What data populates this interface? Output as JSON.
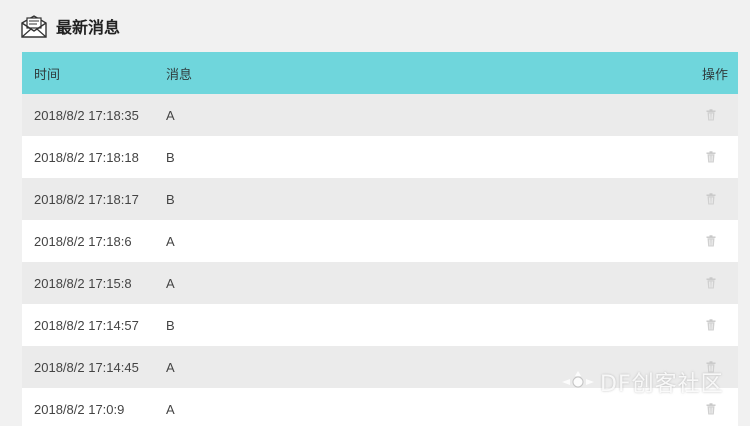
{
  "panel": {
    "title": "最新消息",
    "icon": "mail-envelope-icon"
  },
  "table": {
    "columns": {
      "time": "时间",
      "message": "消息",
      "action": "操作"
    },
    "rows": [
      {
        "time": "2018/8/2 17:18:35",
        "message": "A",
        "action_icon": "trash-icon"
      },
      {
        "time": "2018/8/2 17:18:18",
        "message": "B",
        "action_icon": "trash-icon"
      },
      {
        "time": "2018/8/2 17:18:17",
        "message": "B",
        "action_icon": "trash-icon"
      },
      {
        "time": "2018/8/2 17:18:6",
        "message": "A",
        "action_icon": "trash-icon"
      },
      {
        "time": "2018/8/2 17:15:8",
        "message": "A",
        "action_icon": "trash-icon"
      },
      {
        "time": "2018/8/2 17:14:57",
        "message": "B",
        "action_icon": "trash-icon"
      },
      {
        "time": "2018/8/2 17:14:45",
        "message": "A",
        "action_icon": "trash-icon"
      },
      {
        "time": "2018/8/2 17:0:9",
        "message": "A",
        "action_icon": "trash-icon"
      }
    ]
  },
  "watermark": {
    "text": "DF创客社区"
  },
  "colors": {
    "header_bg": "#6fd6dc",
    "row_alt_bg": "#ebebeb",
    "row_bg": "#ffffff",
    "page_bg": "#f1f1f1"
  }
}
